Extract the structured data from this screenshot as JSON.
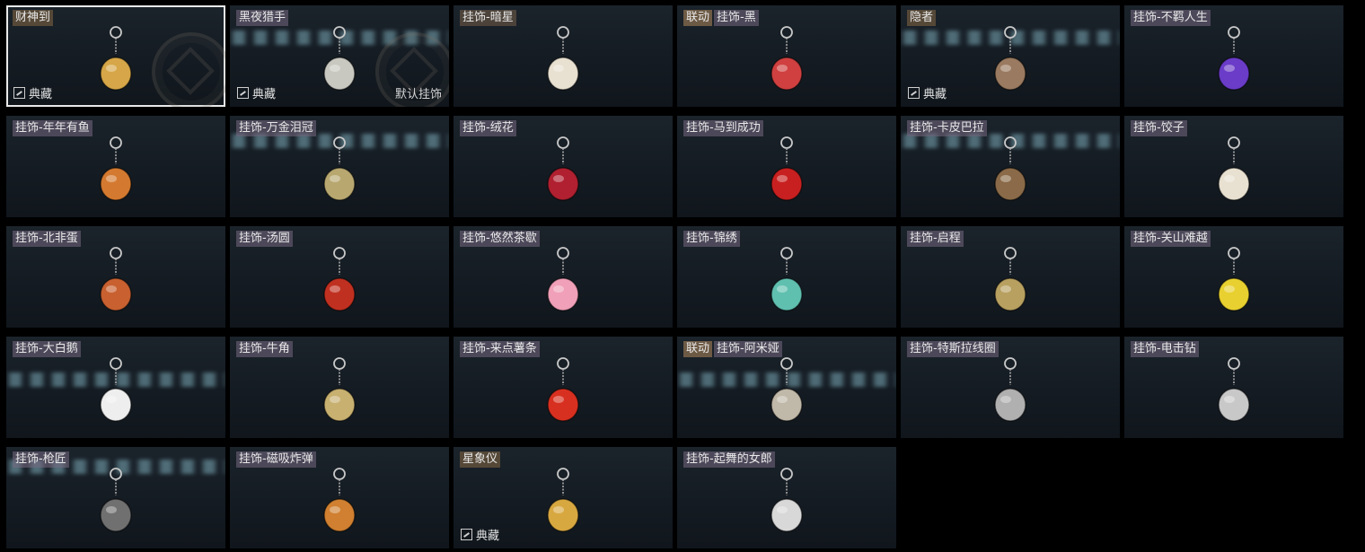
{
  "labels": {
    "legend_badge": "典藏",
    "default_label": "默认挂饰"
  },
  "items": [
    {
      "tags": [
        {
          "text": "财神到",
          "kind": "legend"
        }
      ],
      "badge": true,
      "emblem": true,
      "selected": true,
      "icon": "caishen-charm-icon",
      "color": "#d6a648"
    },
    {
      "tags": [
        {
          "text": "黑夜猎手",
          "kind": "normal"
        }
      ],
      "badge": true,
      "emblem": true,
      "default": true,
      "stripe": 1,
      "icon": "night-hunter-charm-icon",
      "color": "#c8c8c0"
    },
    {
      "tags": [
        {
          "text": "挂饰-暗星",
          "kind": "rare"
        }
      ],
      "icon": "dark-star-charm-icon",
      "color": "#e8e0d0"
    },
    {
      "tags": [
        {
          "text": "联动",
          "kind": "collab"
        },
        {
          "text": "挂饰-黑",
          "kind": "normal"
        }
      ],
      "icon": "black-tag-charm-icon",
      "color": "#d04040"
    },
    {
      "tags": [
        {
          "text": "隐者",
          "kind": "legend"
        }
      ],
      "badge": true,
      "stripe": 1,
      "icon": "hermit-card-charm-icon",
      "color": "#9a7a60"
    },
    {
      "tags": [
        {
          "text": "挂饰-不羁人生",
          "kind": "normal"
        }
      ],
      "icon": "sneaker-charm-icon",
      "color": "#6a3cc8"
    },
    {
      "tags": [
        {
          "text": "挂饰-年年有鱼",
          "kind": "normal"
        }
      ],
      "icon": "fish-plate-charm-icon",
      "color": "#d47a30"
    },
    {
      "tags": [
        {
          "text": "挂饰-万金泪冠",
          "kind": "normal"
        }
      ],
      "stripe": 1,
      "icon": "burger-charm-icon",
      "color": "#b8a870"
    },
    {
      "tags": [
        {
          "text": "挂饰-绒花",
          "kind": "normal"
        }
      ],
      "icon": "rose-charm-icon",
      "color": "#b02030"
    },
    {
      "tags": [
        {
          "text": "挂饰-马到成功",
          "kind": "normal"
        }
      ],
      "icon": "red-horse-charm-icon",
      "color": "#c82020"
    },
    {
      "tags": [
        {
          "text": "挂饰-卡皮巴拉",
          "kind": "normal"
        }
      ],
      "stripe": 1,
      "icon": "capybara-charm-icon",
      "color": "#8a6a48"
    },
    {
      "tags": [
        {
          "text": "挂饰-饺子",
          "kind": "normal"
        }
      ],
      "icon": "dumpling-plate-charm-icon",
      "color": "#e8e0d0"
    },
    {
      "tags": [
        {
          "text": "挂饰-北非蛋",
          "kind": "normal"
        }
      ],
      "icon": "shakshuka-charm-icon",
      "color": "#c86030"
    },
    {
      "tags": [
        {
          "text": "挂饰-汤圆",
          "kind": "normal"
        }
      ],
      "icon": "tangyuan-bowl-charm-icon",
      "color": "#c03020"
    },
    {
      "tags": [
        {
          "text": "挂饰-悠然茶歇",
          "kind": "normal"
        }
      ],
      "icon": "cupcake-charm-icon",
      "color": "#f0a0b8"
    },
    {
      "tags": [
        {
          "text": "挂饰-锦绣",
          "kind": "normal"
        }
      ],
      "icon": "butterfly-charm-icon",
      "color": "#60c0b0"
    },
    {
      "tags": [
        {
          "text": "挂饰-启程",
          "kind": "normal"
        }
      ],
      "icon": "medallion-charm-icon",
      "color": "#b8a060"
    },
    {
      "tags": [
        {
          "text": "挂饰-关山难越",
          "kind": "normal"
        }
      ],
      "icon": "yellow-tube-charm-icon",
      "color": "#e8d030"
    },
    {
      "tags": [
        {
          "text": "挂饰-大白鹅",
          "kind": "normal"
        }
      ],
      "stripe": 1,
      "icon": "goose-charm-icon",
      "color": "#eeeeee"
    },
    {
      "tags": [
        {
          "text": "挂饰-牛角",
          "kind": "normal"
        }
      ],
      "icon": "bull-horns-charm-icon",
      "color": "#c8b070"
    },
    {
      "tags": [
        {
          "text": "挂饰-来点薯条",
          "kind": "normal"
        }
      ],
      "icon": "fries-charm-icon",
      "color": "#d83020"
    },
    {
      "tags": [
        {
          "text": "联动",
          "kind": "collab"
        },
        {
          "text": "挂饰-阿米娅",
          "kind": "normal"
        }
      ],
      "stripe": 1,
      "icon": "amiya-charm-icon",
      "color": "#c0b8a8"
    },
    {
      "tags": [
        {
          "text": "挂饰-特斯拉线圈",
          "kind": "normal"
        }
      ],
      "icon": "tesla-coil-charm-icon",
      "color": "#b0b0b0"
    },
    {
      "tags": [
        {
          "text": "挂饰-电击钻",
          "kind": "normal"
        }
      ],
      "icon": "drill-charm-icon",
      "color": "#c8c8c8"
    },
    {
      "tags": [
        {
          "text": "挂饰-枪匠",
          "kind": "normal"
        }
      ],
      "stripe": 1,
      "icon": "gunsmith-case-charm-icon",
      "color": "#707070"
    },
    {
      "tags": [
        {
          "text": "挂饰-磁吸炸弹",
          "kind": "normal"
        }
      ],
      "icon": "magnet-bomb-charm-icon",
      "color": "#d08030"
    },
    {
      "tags": [
        {
          "text": "星象仪",
          "kind": "legend"
        }
      ],
      "badge": true,
      "icon": "astrolabe-charm-icon",
      "color": "#d8a840"
    },
    {
      "tags": [
        {
          "text": "挂饰-起舞的女郎",
          "kind": "normal"
        }
      ],
      "icon": "dancer-statue-charm-icon",
      "color": "#d8d8d8"
    }
  ]
}
